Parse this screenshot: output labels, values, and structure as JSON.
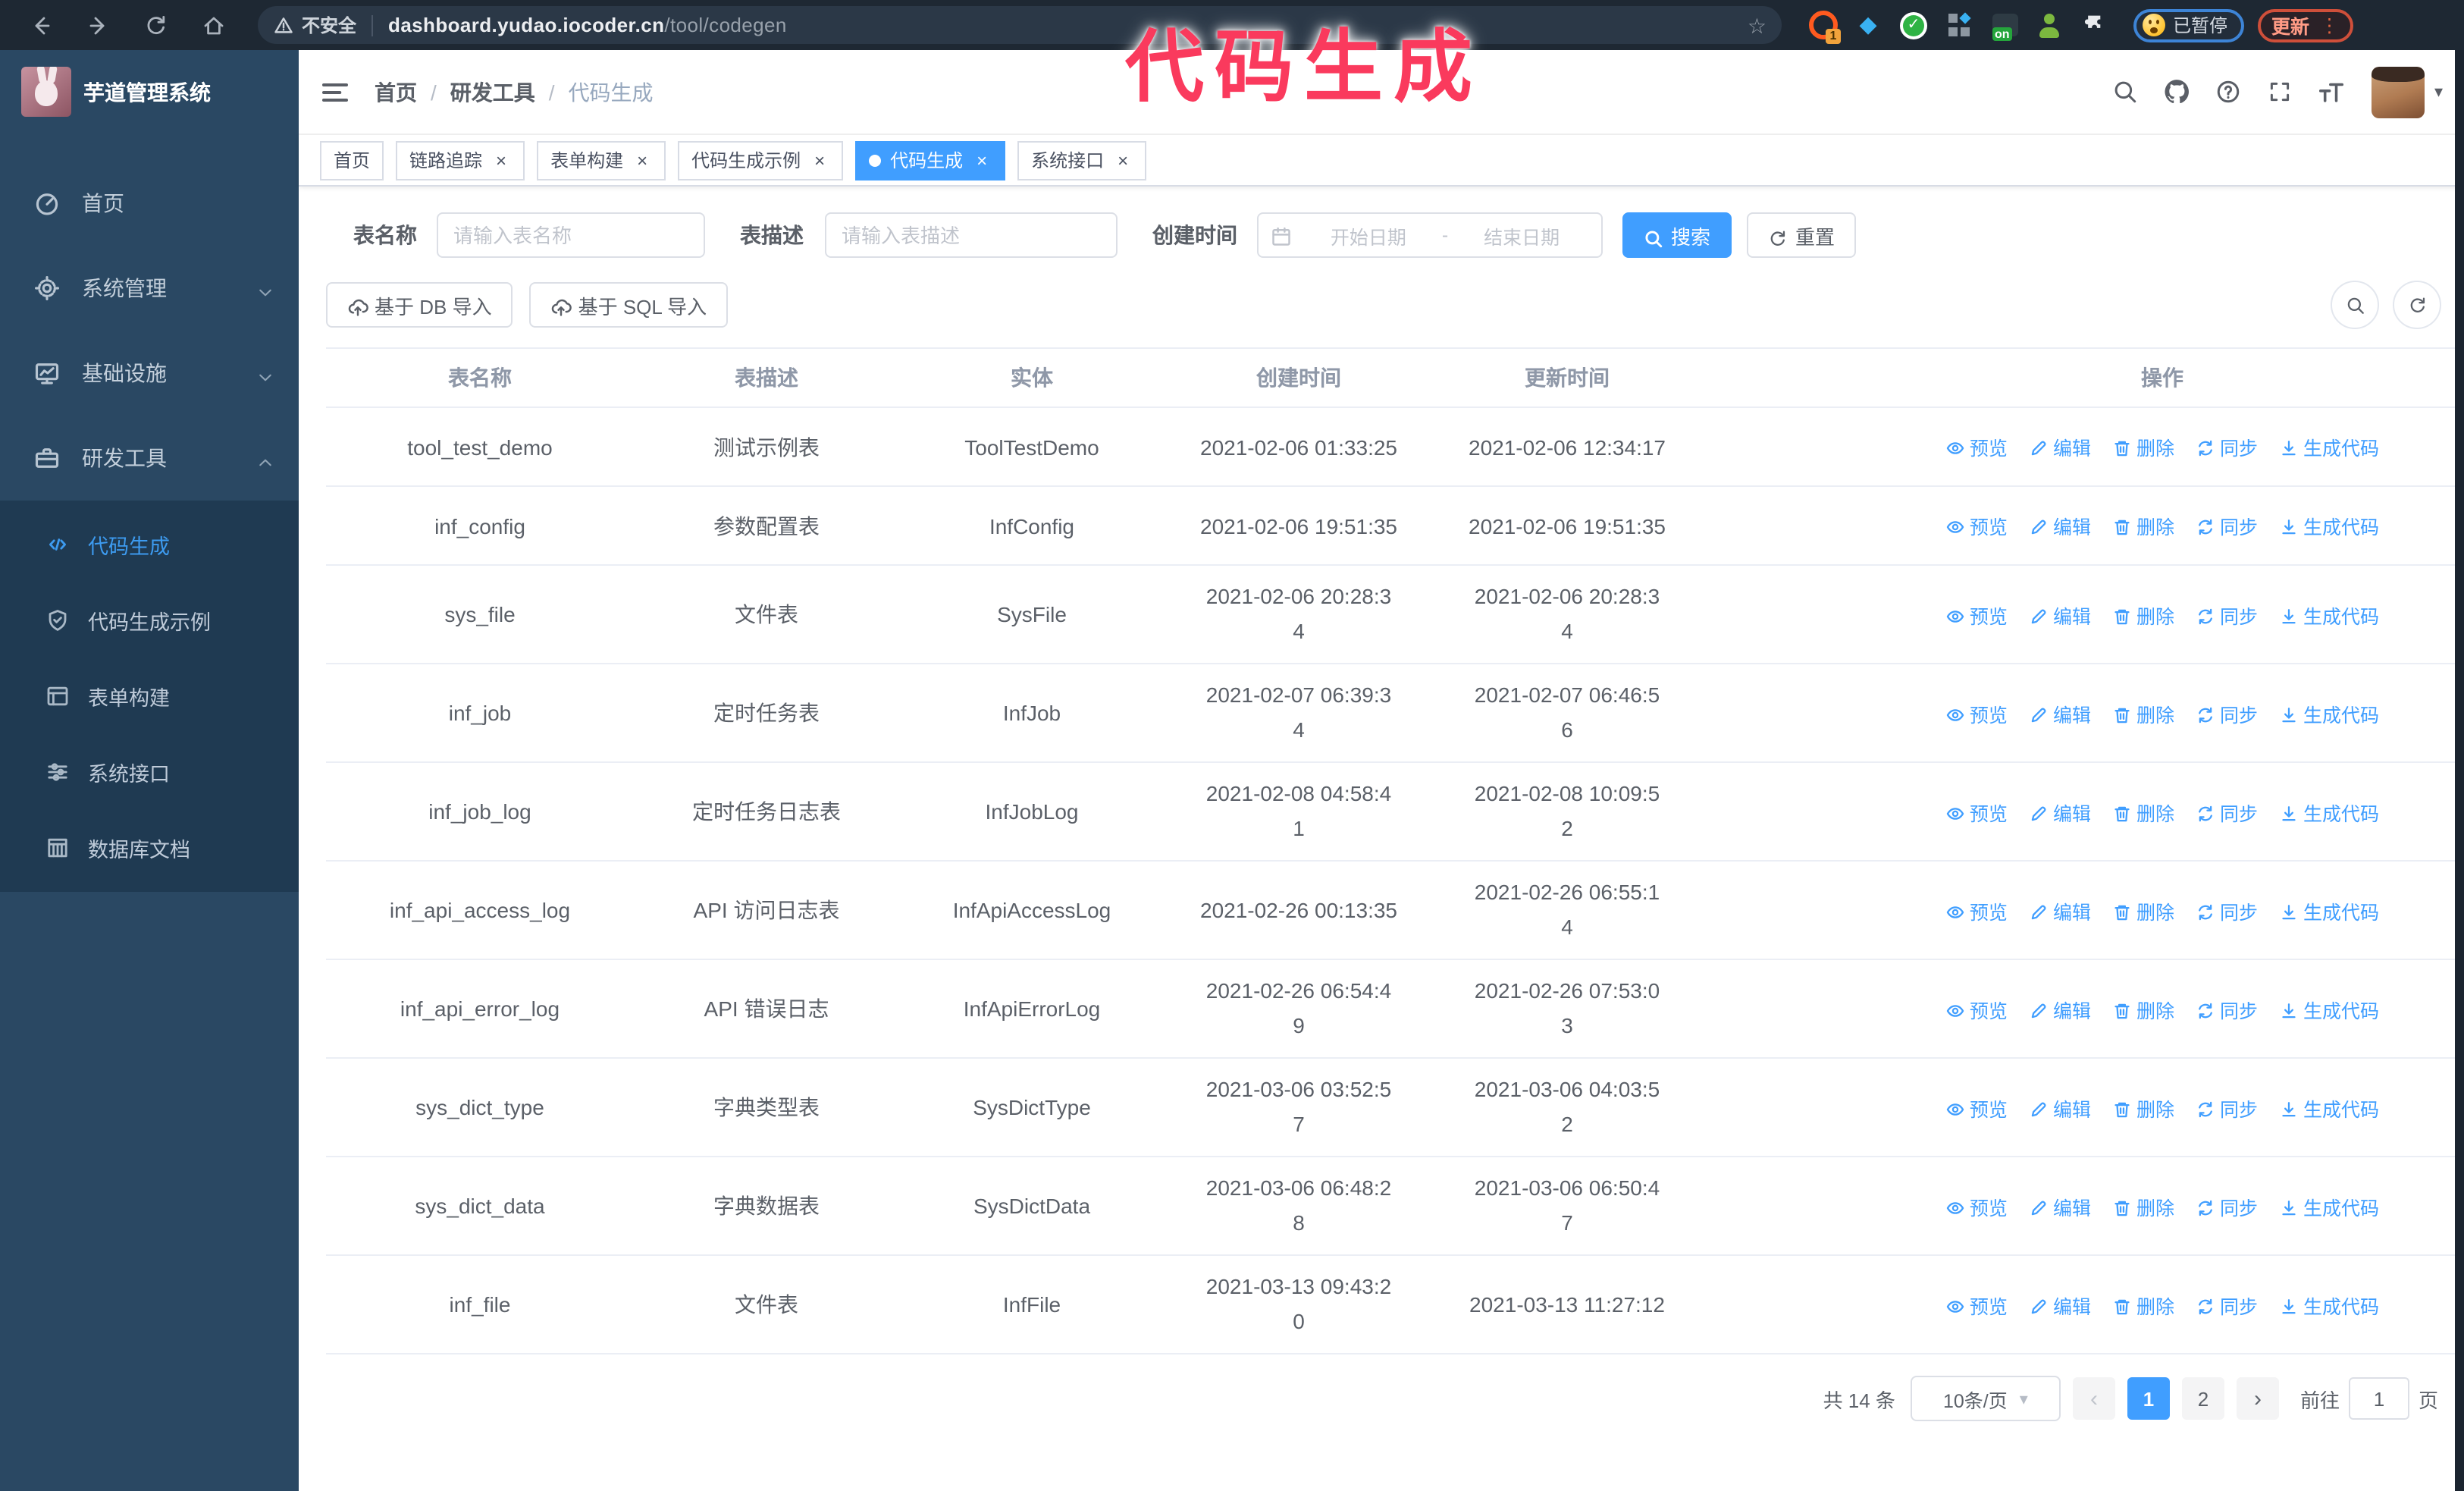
{
  "annotation": {
    "text": "代码生成",
    "color": "#fa3a5d"
  },
  "browser": {
    "security_label": "不安全",
    "url_host": "dashboard.yudao.iocoder.cn",
    "url_path": "/tool/codegen",
    "paused_badge": "已暂停",
    "update_label": "更新"
  },
  "sidebar": {
    "app_title": "芋道管理系统",
    "items": [
      {
        "key": "home",
        "label": "首页",
        "icon": "dashboard-icon",
        "chevron": ""
      },
      {
        "key": "system-management",
        "label": "系统管理",
        "icon": "gear-icon",
        "chevron": "down"
      },
      {
        "key": "infrastructure",
        "label": "基础设施",
        "icon": "monitor-icon",
        "chevron": "down"
      },
      {
        "key": "dev-tools",
        "label": "研发工具",
        "icon": "toolbox-icon",
        "chevron": "up"
      }
    ],
    "subitems": [
      {
        "key": "codegen",
        "label": "代码生成",
        "icon": "code-icon",
        "active": true
      },
      {
        "key": "codegen-example",
        "label": "代码生成示例",
        "icon": "shield-icon",
        "active": false
      },
      {
        "key": "form-builder",
        "label": "表单构建",
        "icon": "form-icon",
        "active": false
      },
      {
        "key": "system-api",
        "label": "系统接口",
        "icon": "sliders-icon",
        "active": false
      },
      {
        "key": "db-doc",
        "label": "数据库文档",
        "icon": "database-icon",
        "active": false
      }
    ]
  },
  "breadcrumb": {
    "items": [
      "首页",
      "研发工具",
      "代码生成"
    ]
  },
  "tabs": [
    {
      "key": "home",
      "label": "首页",
      "closable": false,
      "active": false
    },
    {
      "key": "trace",
      "label": "链路追踪",
      "closable": true,
      "active": false
    },
    {
      "key": "form-builder",
      "label": "表单构建",
      "closable": true,
      "active": false
    },
    {
      "key": "codegen-example",
      "label": "代码生成示例",
      "closable": true,
      "active": false
    },
    {
      "key": "codegen",
      "label": "代码生成",
      "closable": true,
      "active": true
    },
    {
      "key": "system-api",
      "label": "系统接口",
      "closable": true,
      "active": false
    }
  ],
  "filters": {
    "table_name_label": "表名称",
    "table_name_placeholder": "请输入表名称",
    "table_desc_label": "表描述",
    "table_desc_placeholder": "请输入表描述",
    "create_time_label": "创建时间",
    "date_start_placeholder": "开始日期",
    "date_separator": "-",
    "date_end_placeholder": "结束日期",
    "search_label": "搜索",
    "reset_label": "重置"
  },
  "toolbar": {
    "import_db_label": "基于 DB 导入",
    "import_sql_label": "基于 SQL 导入"
  },
  "table": {
    "columns": [
      "表名称",
      "表描述",
      "实体",
      "创建时间",
      "更新时间",
      "操作"
    ],
    "actions": [
      {
        "key": "preview",
        "label": "预览",
        "icon": "eye-icon"
      },
      {
        "key": "edit",
        "label": "编辑",
        "icon": "edit-icon"
      },
      {
        "key": "delete",
        "label": "删除",
        "icon": "trash-icon"
      },
      {
        "key": "sync",
        "label": "同步",
        "icon": "sync-icon"
      },
      {
        "key": "generate",
        "label": "生成代码",
        "icon": "download-icon"
      }
    ],
    "rows": [
      {
        "name": "tool_test_demo",
        "description": "测试示例表",
        "entity": "ToolTestDemo",
        "created_at": "2021-02-06 01:33:25",
        "updated_at": "2021-02-06 12:34:17"
      },
      {
        "name": "inf_config",
        "description": "参数配置表",
        "entity": "InfConfig",
        "created_at": "2021-02-06 19:51:35",
        "updated_at": "2021-02-06 19:51:35"
      },
      {
        "name": "sys_file",
        "description": "文件表",
        "entity": "SysFile",
        "created_at": "2021-02-06 20:28:34",
        "updated_at": "2021-02-06 20:28:34"
      },
      {
        "name": "inf_job",
        "description": "定时任务表",
        "entity": "InfJob",
        "created_at": "2021-02-07 06:39:34",
        "updated_at": "2021-02-07 06:46:56"
      },
      {
        "name": "inf_job_log",
        "description": "定时任务日志表",
        "entity": "InfJobLog",
        "created_at": "2021-02-08 04:58:41",
        "updated_at": "2021-02-08 10:09:52"
      },
      {
        "name": "inf_api_access_log",
        "description": "API 访问日志表",
        "entity": "InfApiAccessLog",
        "created_at": "2021-02-26 00:13:35",
        "updated_at": "2021-02-26 06:55:14"
      },
      {
        "name": "inf_api_error_log",
        "description": "API 错误日志",
        "entity": "InfApiErrorLog",
        "created_at": "2021-02-26 06:54:49",
        "updated_at": "2021-02-26 07:53:03"
      },
      {
        "name": "sys_dict_type",
        "description": "字典类型表",
        "entity": "SysDictType",
        "created_at": "2021-03-06 03:52:57",
        "updated_at": "2021-03-06 04:03:52"
      },
      {
        "name": "sys_dict_data",
        "description": "字典数据表",
        "entity": "SysDictData",
        "created_at": "2021-03-06 06:48:28",
        "updated_at": "2021-03-06 06:50:47"
      },
      {
        "name": "inf_file",
        "description": "文件表",
        "entity": "InfFile",
        "created_at": "2021-03-13 09:43:20",
        "updated_at": "2021-03-13 11:27:12"
      }
    ]
  },
  "pagination": {
    "total_text": "共 14 条",
    "page_size": "10条/页",
    "prev_label": "‹",
    "next_label": "›",
    "pages": [
      "1",
      "2"
    ],
    "active_page": "1",
    "goto_label": "前往",
    "goto_value": "1",
    "goto_suffix": "页"
  },
  "colors": {
    "accent": "#409eff",
    "annotation": "#fa3a5d",
    "sidebar_bg": "#2a4863",
    "submenu_bg": "#1f3a52",
    "browser_bar_bg": "#1e2833"
  }
}
